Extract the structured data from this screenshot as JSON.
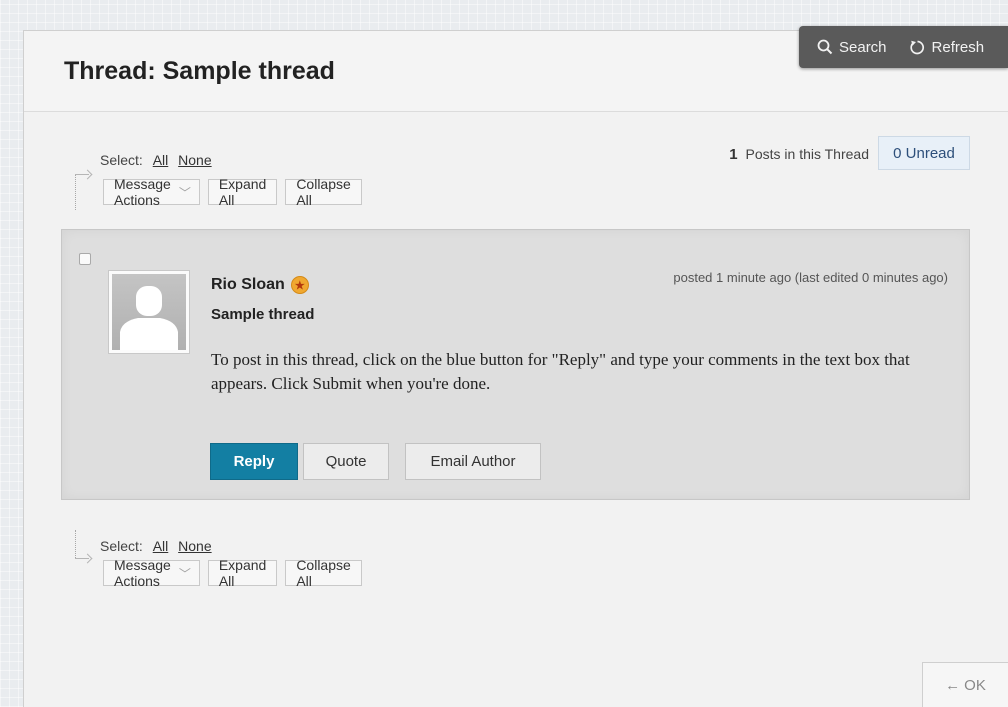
{
  "page": {
    "title": "Thread: Sample thread"
  },
  "topbar": {
    "search_label": "Search",
    "refresh_label": "Refresh"
  },
  "select": {
    "label": "Select:",
    "all": "All",
    "none": "None"
  },
  "toolbar": {
    "message_actions": "Message Actions",
    "expand_all": "Expand All",
    "collapse_all": "Collapse All"
  },
  "thread_stats": {
    "post_count": "1",
    "posts_label": "Posts in this Thread",
    "unread": "0 Unread"
  },
  "post": {
    "author": "Rio Sloan",
    "timestamp": "posted 1 minute ago (last edited 0 minutes ago)",
    "subject": "Sample thread",
    "body": "To post in this thread, click on the blue button for \"Reply\" and type your comments in the text box that appears. Click Submit when you're done.",
    "actions": {
      "reply": "Reply",
      "quote": "Quote",
      "email_author": "Email Author"
    }
  },
  "footer": {
    "ok_label": "OK",
    "ok_arrow": "←"
  },
  "colors": {
    "primary_button": "#137fa3",
    "topbar_bg": "#5a5a5a",
    "unread_bg": "#e8f0f8",
    "author_badge": "#f0a830"
  }
}
